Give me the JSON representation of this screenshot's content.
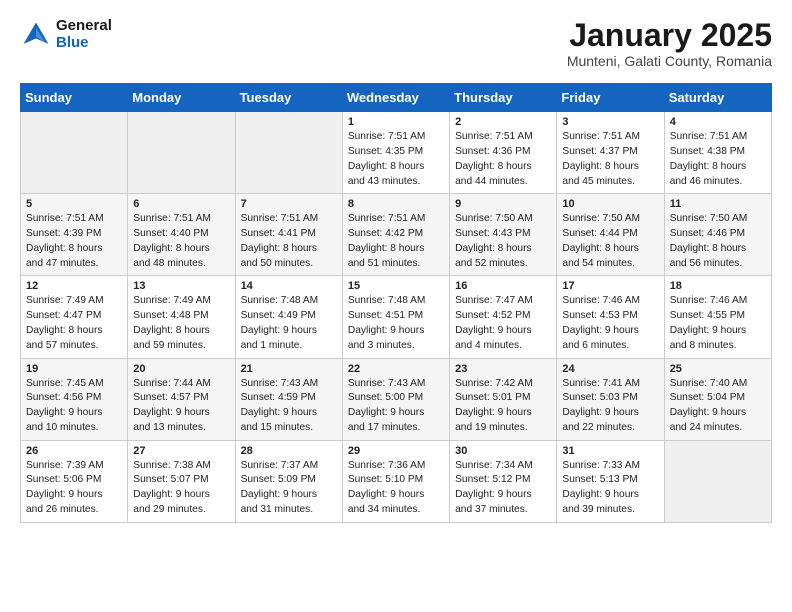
{
  "header": {
    "logo_line1": "General",
    "logo_line2": "Blue",
    "month": "January 2025",
    "location": "Munteni, Galati County, Romania"
  },
  "weekdays": [
    "Sunday",
    "Monday",
    "Tuesday",
    "Wednesday",
    "Thursday",
    "Friday",
    "Saturday"
  ],
  "weeks": [
    [
      {
        "day": "",
        "info": ""
      },
      {
        "day": "",
        "info": ""
      },
      {
        "day": "",
        "info": ""
      },
      {
        "day": "1",
        "info": "Sunrise: 7:51 AM\nSunset: 4:35 PM\nDaylight: 8 hours\nand 43 minutes."
      },
      {
        "day": "2",
        "info": "Sunrise: 7:51 AM\nSunset: 4:36 PM\nDaylight: 8 hours\nand 44 minutes."
      },
      {
        "day": "3",
        "info": "Sunrise: 7:51 AM\nSunset: 4:37 PM\nDaylight: 8 hours\nand 45 minutes."
      },
      {
        "day": "4",
        "info": "Sunrise: 7:51 AM\nSunset: 4:38 PM\nDaylight: 8 hours\nand 46 minutes."
      }
    ],
    [
      {
        "day": "5",
        "info": "Sunrise: 7:51 AM\nSunset: 4:39 PM\nDaylight: 8 hours\nand 47 minutes."
      },
      {
        "day": "6",
        "info": "Sunrise: 7:51 AM\nSunset: 4:40 PM\nDaylight: 8 hours\nand 48 minutes."
      },
      {
        "day": "7",
        "info": "Sunrise: 7:51 AM\nSunset: 4:41 PM\nDaylight: 8 hours\nand 50 minutes."
      },
      {
        "day": "8",
        "info": "Sunrise: 7:51 AM\nSunset: 4:42 PM\nDaylight: 8 hours\nand 51 minutes."
      },
      {
        "day": "9",
        "info": "Sunrise: 7:50 AM\nSunset: 4:43 PM\nDaylight: 8 hours\nand 52 minutes."
      },
      {
        "day": "10",
        "info": "Sunrise: 7:50 AM\nSunset: 4:44 PM\nDaylight: 8 hours\nand 54 minutes."
      },
      {
        "day": "11",
        "info": "Sunrise: 7:50 AM\nSunset: 4:46 PM\nDaylight: 8 hours\nand 56 minutes."
      }
    ],
    [
      {
        "day": "12",
        "info": "Sunrise: 7:49 AM\nSunset: 4:47 PM\nDaylight: 8 hours\nand 57 minutes."
      },
      {
        "day": "13",
        "info": "Sunrise: 7:49 AM\nSunset: 4:48 PM\nDaylight: 8 hours\nand 59 minutes."
      },
      {
        "day": "14",
        "info": "Sunrise: 7:48 AM\nSunset: 4:49 PM\nDaylight: 9 hours\nand 1 minute."
      },
      {
        "day": "15",
        "info": "Sunrise: 7:48 AM\nSunset: 4:51 PM\nDaylight: 9 hours\nand 3 minutes."
      },
      {
        "day": "16",
        "info": "Sunrise: 7:47 AM\nSunset: 4:52 PM\nDaylight: 9 hours\nand 4 minutes."
      },
      {
        "day": "17",
        "info": "Sunrise: 7:46 AM\nSunset: 4:53 PM\nDaylight: 9 hours\nand 6 minutes."
      },
      {
        "day": "18",
        "info": "Sunrise: 7:46 AM\nSunset: 4:55 PM\nDaylight: 9 hours\nand 8 minutes."
      }
    ],
    [
      {
        "day": "19",
        "info": "Sunrise: 7:45 AM\nSunset: 4:56 PM\nDaylight: 9 hours\nand 10 minutes."
      },
      {
        "day": "20",
        "info": "Sunrise: 7:44 AM\nSunset: 4:57 PM\nDaylight: 9 hours\nand 13 minutes."
      },
      {
        "day": "21",
        "info": "Sunrise: 7:43 AM\nSunset: 4:59 PM\nDaylight: 9 hours\nand 15 minutes."
      },
      {
        "day": "22",
        "info": "Sunrise: 7:43 AM\nSunset: 5:00 PM\nDaylight: 9 hours\nand 17 minutes."
      },
      {
        "day": "23",
        "info": "Sunrise: 7:42 AM\nSunset: 5:01 PM\nDaylight: 9 hours\nand 19 minutes."
      },
      {
        "day": "24",
        "info": "Sunrise: 7:41 AM\nSunset: 5:03 PM\nDaylight: 9 hours\nand 22 minutes."
      },
      {
        "day": "25",
        "info": "Sunrise: 7:40 AM\nSunset: 5:04 PM\nDaylight: 9 hours\nand 24 minutes."
      }
    ],
    [
      {
        "day": "26",
        "info": "Sunrise: 7:39 AM\nSunset: 5:06 PM\nDaylight: 9 hours\nand 26 minutes."
      },
      {
        "day": "27",
        "info": "Sunrise: 7:38 AM\nSunset: 5:07 PM\nDaylight: 9 hours\nand 29 minutes."
      },
      {
        "day": "28",
        "info": "Sunrise: 7:37 AM\nSunset: 5:09 PM\nDaylight: 9 hours\nand 31 minutes."
      },
      {
        "day": "29",
        "info": "Sunrise: 7:36 AM\nSunset: 5:10 PM\nDaylight: 9 hours\nand 34 minutes."
      },
      {
        "day": "30",
        "info": "Sunrise: 7:34 AM\nSunset: 5:12 PM\nDaylight: 9 hours\nand 37 minutes."
      },
      {
        "day": "31",
        "info": "Sunrise: 7:33 AM\nSunset: 5:13 PM\nDaylight: 9 hours\nand 39 minutes."
      },
      {
        "day": "",
        "info": ""
      }
    ]
  ]
}
